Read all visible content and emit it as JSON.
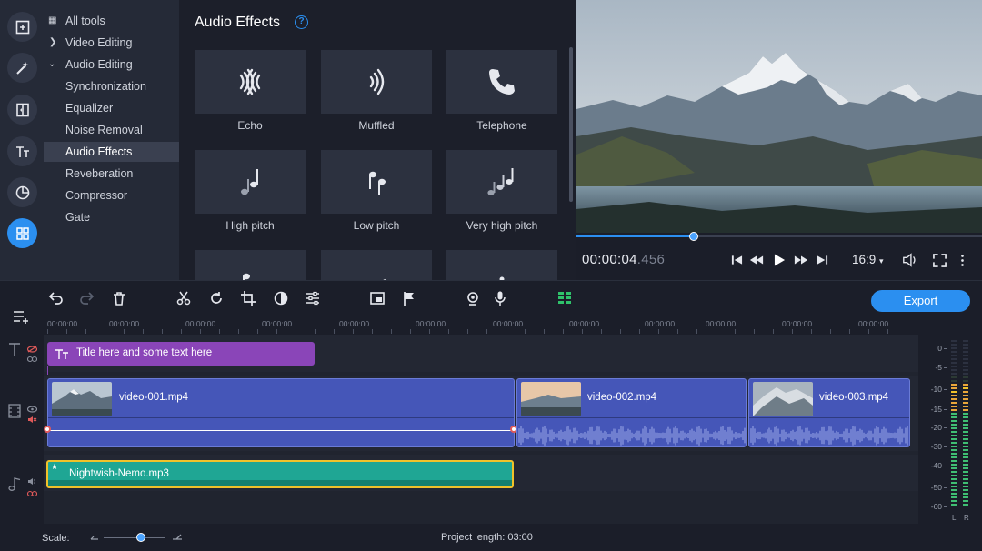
{
  "sidebar": {
    "items": [
      {
        "label": "All tools",
        "prefix": "grid"
      },
      {
        "label": "Video Editing",
        "prefix": "chevron-right"
      },
      {
        "label": "Audio Editing",
        "prefix": "chevron-down"
      },
      {
        "label": "Synchronization"
      },
      {
        "label": "Equalizer"
      },
      {
        "label": "Noise Removal"
      },
      {
        "label": "Audio Effects",
        "selected": true
      },
      {
        "label": "Reveberation"
      },
      {
        "label": "Compressor"
      },
      {
        "label": "Gate"
      }
    ]
  },
  "effects": {
    "title": "Audio Effects",
    "help": "?",
    "tiles": [
      {
        "label": "Echo",
        "icon": "echo-icon"
      },
      {
        "label": "Muffled",
        "icon": "muffled-icon"
      },
      {
        "label": "Telephone",
        "icon": "telephone-icon"
      },
      {
        "label": "High pitch",
        "icon": "high-pitch-icon"
      },
      {
        "label": "Low pitch",
        "icon": "low-pitch-icon"
      },
      {
        "label": "Very high pitch",
        "icon": "very-high-pitch-icon"
      }
    ]
  },
  "preview": {
    "timecode_main": "00:00:04",
    "timecode_ms": ".456",
    "aspect": "16:9",
    "progress": 0.29
  },
  "toolbar": {
    "export_label": "Export"
  },
  "ruler": {
    "labels": [
      "00:00:00",
      "00:00:00",
      "00:00:00",
      "00:00:00",
      "00:00:00",
      "00:00:00",
      "00:00:00",
      "00:00:00",
      "00:00:00",
      "00:00:00",
      "00:00:00",
      "00:00:00"
    ]
  },
  "timeline": {
    "title_clip": "Title here and some text here",
    "video_clips": [
      "video-001.mp4",
      "video-002.mp4",
      "video-003.mp4"
    ],
    "audio_clip": "Nightwish-Nemo.mp3",
    "audio_star": "★"
  },
  "meter": {
    "db_labels": [
      "0",
      "-5",
      "-10",
      "-15",
      "-20",
      "-30",
      "-40",
      "-50",
      "-60"
    ],
    "left_label": "L",
    "right_label": "R"
  },
  "status": {
    "scale_label": "Scale:",
    "project_length": "Project length: 03:00",
    "scale_value": 0.6
  },
  "colors": {
    "accent": "#2b8ff0",
    "title_clip": "#8a45b8",
    "video_clip": "#4556b8",
    "audio_clip": "#1fa694",
    "audio_border": "#f0c22a"
  }
}
